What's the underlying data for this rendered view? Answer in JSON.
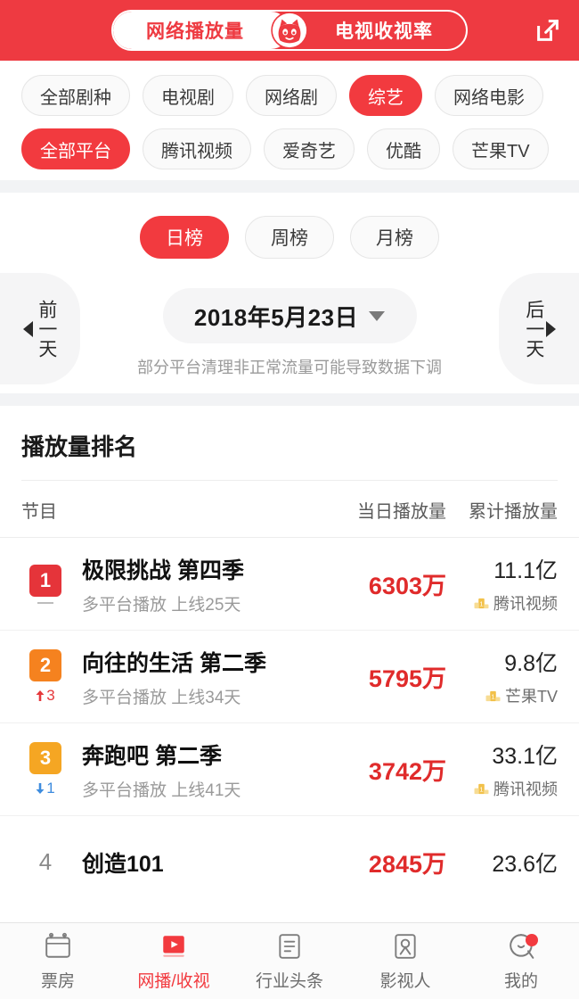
{
  "header": {
    "tab_web_label": "网络播放量",
    "tab_tv_label": "电视收视率",
    "active_tab": "网络播放量",
    "logo_icon": "maoyan-cat-icon",
    "share_icon": "external-link-icon",
    "brand_color": "#EE3A41"
  },
  "filters": {
    "genre_row": [
      {
        "label": "全部剧种",
        "active": false
      },
      {
        "label": "电视剧",
        "active": false
      },
      {
        "label": "网络剧",
        "active": false
      },
      {
        "label": "综艺",
        "active": true
      },
      {
        "label": "网络电影",
        "active": false
      }
    ],
    "platform_row": [
      {
        "label": "全部平台",
        "active": true
      },
      {
        "label": "腾讯视频",
        "active": false
      },
      {
        "label": "爱奇艺",
        "active": false
      },
      {
        "label": "优酷",
        "active": false
      },
      {
        "label": "芒果TV",
        "active": false
      }
    ],
    "active_color": "#F23A3F"
  },
  "period": {
    "tabs": [
      {
        "label": "日榜",
        "active": true
      },
      {
        "label": "周榜",
        "active": false
      },
      {
        "label": "月榜",
        "active": false
      }
    ]
  },
  "date_nav": {
    "prev_label": "前一天",
    "next_label": "后一天",
    "prev_icon": "triangle-left-icon",
    "next_icon": "triangle-right-icon",
    "current_date": "2018年5月23日",
    "caret_icon": "chevron-down-icon",
    "note": "部分平台清理非正常流量可能导致数据下调"
  },
  "ranking": {
    "title": "播放量排名",
    "columns": {
      "program": "节目",
      "daily": "当日播放量",
      "cumulative": "累计播放量"
    },
    "rows": [
      {
        "rank": "1",
        "rank_badge_color": "#E5343A",
        "delta_type": "same",
        "delta_value": "",
        "name": "极限挑战 第四季",
        "sub": "多平台播放 上线25天",
        "daily": "6303万",
        "cumulative": "11.1亿",
        "platform": "腾讯视频",
        "platform_icon": "gold-podium-icon"
      },
      {
        "rank": "2",
        "rank_badge_color": "#F5821F",
        "delta_type": "up",
        "delta_value": "3",
        "name": "向往的生活 第二季",
        "sub": "多平台播放 上线34天",
        "daily": "5795万",
        "cumulative": "9.8亿",
        "platform": "芒果TV",
        "platform_icon": "gold-podium-icon"
      },
      {
        "rank": "3",
        "rank_badge_color": "#F5A623",
        "delta_type": "down",
        "delta_value": "1",
        "name": "奔跑吧 第二季",
        "sub": "多平台播放 上线41天",
        "daily": "3742万",
        "cumulative": "33.1亿",
        "platform": "腾讯视频",
        "platform_icon": "gold-podium-icon"
      },
      {
        "rank": "4",
        "rank_badge_color": "",
        "delta_type": "none",
        "delta_value": "",
        "name": "创造101",
        "sub": "",
        "daily": "2845万",
        "cumulative": "23.6亿",
        "platform": "",
        "platform_icon": ""
      }
    ]
  },
  "tabbar": {
    "items": [
      {
        "label": "票房",
        "icon": "calendar-icon",
        "active": false,
        "badge": false
      },
      {
        "label": "网播/收视",
        "icon": "play-video-icon",
        "active": true,
        "badge": false
      },
      {
        "label": "行业头条",
        "icon": "news-icon",
        "active": false,
        "badge": false
      },
      {
        "label": "影视人",
        "icon": "person-icon",
        "active": false,
        "badge": false
      },
      {
        "label": "我的",
        "icon": "smiley-face-icon",
        "active": false,
        "badge": true
      }
    ],
    "active_color": "#F23A3F"
  }
}
